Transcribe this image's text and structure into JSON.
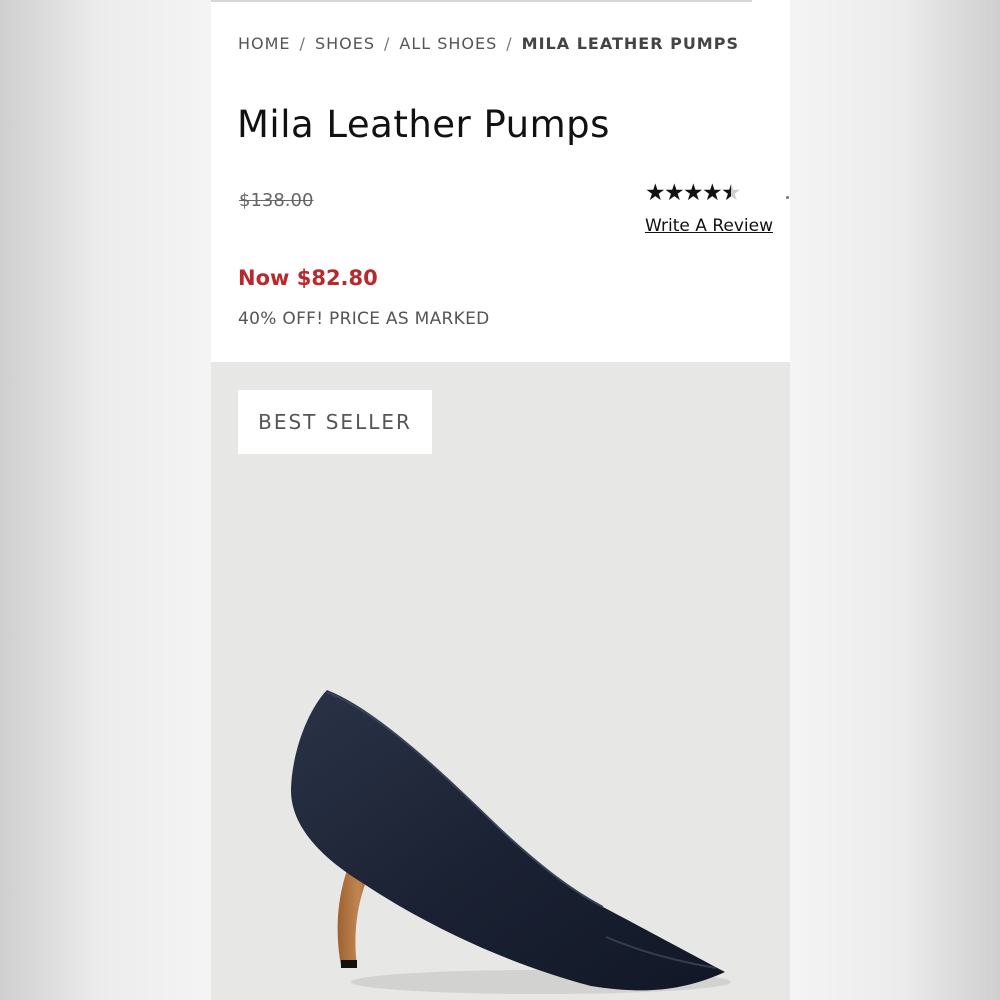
{
  "breadcrumb": {
    "items": [
      "HOME",
      "SHOES",
      "ALL SHOES"
    ],
    "separator": "/",
    "current": "MILA LEATHER PUMPS"
  },
  "product": {
    "title": "Mila Leather Pumps",
    "original_price": "$138.00",
    "sale_price": "Now $82.80",
    "promo": "40% OFF! PRICE AS MARKED",
    "badge": "BEST SELLER",
    "image_icon": "navy-pointed-toe-pump-photo"
  },
  "rating": {
    "stars": 4.5,
    "max": 5,
    "write_review_label": "Write A Review"
  },
  "colors": {
    "sale": "#b9282d",
    "shoe": "#1c2436",
    "lining": "#b47a45"
  }
}
